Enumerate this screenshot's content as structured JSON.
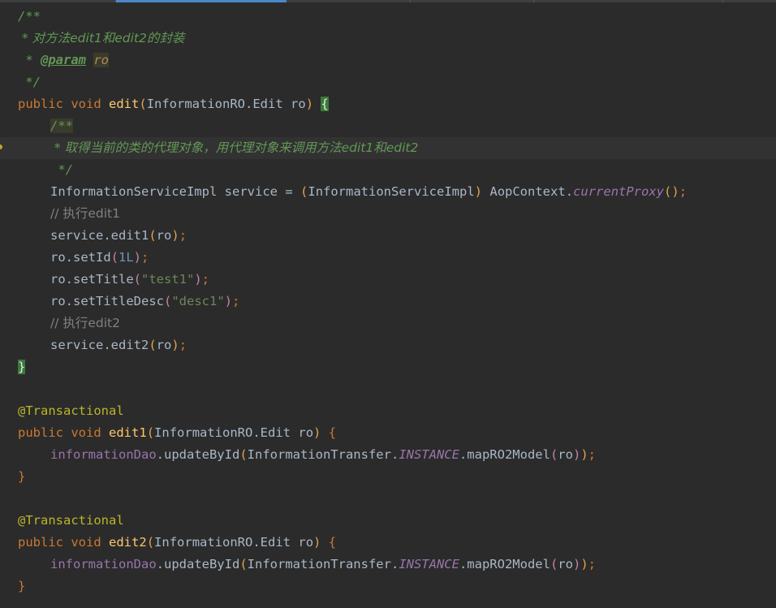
{
  "editor": {
    "colors": {
      "background": "#2b2b2b",
      "keyword": "#cc7832",
      "method": "#ffc66d",
      "doc_comment": "#629755",
      "line_comment": "#808080",
      "string": "#6a8759",
      "number": "#6897bb",
      "annotation": "#bbb529",
      "field": "#9876aa",
      "plain": "#a9b7c6",
      "active_tab": "#4a88c7"
    },
    "doc1": {
      "open": "/**",
      "desc": " * 对方法edit1和edit2的封装",
      "param_prefix": " * ",
      "param_tag": "@param",
      "param_name": "ro",
      "close": " */"
    },
    "edit_method": {
      "public": "public",
      "void": "void",
      "name": "edit",
      "param_type": "InformationRO.Edit",
      "param_name": "ro",
      "open_brace": "{",
      "close_brace": "}"
    },
    "doc2": {
      "open": "/**",
      "desc": " * 取得当前的类的代理对象，用代理对象来调用方法edit1和edit2",
      "close": " */"
    },
    "body": {
      "proxy_type": "InformationServiceImpl",
      "proxy_var": "service",
      "assign": "=",
      "cast_type": "InformationServiceImpl",
      "aop_class": "AopContext",
      "aop_method": "currentProxy",
      "comment1": "// 执行edit1",
      "call_edit1": "service.edit1",
      "arg_ro": "ro",
      "setid": "ro.setId",
      "setid_value": "1L",
      "settitle": "ro.setTitle",
      "settitle_value": "\"test1\"",
      "settitledesc": "ro.setTitleDesc",
      "settitledesc_value": "\"desc1\"",
      "comment2": "// 执行edit2",
      "call_edit2": "service.edit2"
    },
    "edit1_method": {
      "annotation": "@Transactional",
      "public": "public",
      "void": "void",
      "name": "edit1",
      "param_type": "InformationRO.Edit",
      "param_name": "ro",
      "open_brace": "{",
      "dao": "informationDao",
      "dao_method": ".updateById",
      "transfer": "InformationTransfer",
      "instance": "INSTANCE",
      "map_method": ".mapRO2Model",
      "arg": "ro",
      "close_brace": "}"
    },
    "edit2_method": {
      "annotation": "@Transactional",
      "public": "public",
      "void": "void",
      "name": "edit2",
      "param_type": "InformationRO.Edit",
      "param_name": "ro",
      "open_brace": "{",
      "dao": "informationDao",
      "dao_method": ".updateById",
      "transfer": "InformationTransfer",
      "instance": "INSTANCE",
      "map_method": ".mapRO2Model",
      "arg": "ro",
      "close_brace": "}"
    }
  }
}
